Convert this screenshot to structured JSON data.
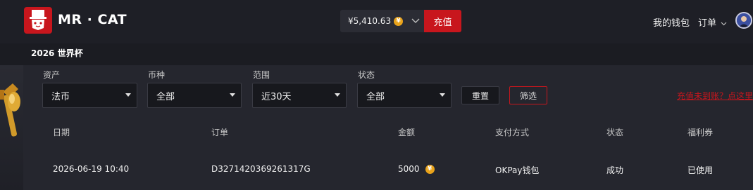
{
  "header": {
    "brand": "MR · CAT",
    "wallet_balance": "¥5,410.63",
    "coin_symbol": "¥",
    "recharge_label": "充值",
    "my_wallet_label": "我的钱包",
    "orders_label": "订单",
    "subtitle": "2026 世界杯"
  },
  "filters": {
    "asset": {
      "label": "资产",
      "value": "法币"
    },
    "currency": {
      "label": "币种",
      "value": "全部"
    },
    "range": {
      "label": "范围",
      "value": "近30天"
    },
    "status": {
      "label": "状态",
      "value": "全部"
    },
    "reset_label": "重置",
    "filter_label": "筛选",
    "recharge_link": "充值未到账？点这里"
  },
  "table": {
    "columns": [
      "日期",
      "订单",
      "金额",
      "支付方式",
      "状态",
      "福利券"
    ],
    "rows": [
      {
        "date": "2026-06-19 10:40",
        "order": "D3271420369261317G",
        "amount": "5000",
        "method": "OKPay钱包",
        "status": "成功",
        "coupon": "已使用"
      }
    ]
  },
  "colors": {
    "accent": "#c8161d",
    "coin": "#e9a31b",
    "background": "#1b1c22",
    "panel": "#25262e"
  },
  "icons": {
    "logo": "cat-top-hat-logo",
    "coin": "coin-icon",
    "chevron": "chevron-down-icon",
    "caret": "caret-down-icon",
    "avatar": "user-avatar"
  }
}
